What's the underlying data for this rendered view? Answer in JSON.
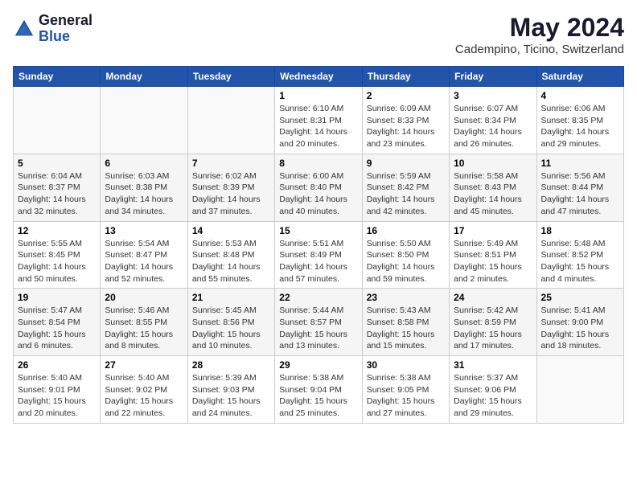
{
  "header": {
    "logo_general": "General",
    "logo_blue": "Blue",
    "title": "May 2024",
    "subtitle": "Cadempino, Ticino, Switzerland"
  },
  "weekdays": [
    "Sunday",
    "Monday",
    "Tuesday",
    "Wednesday",
    "Thursday",
    "Friday",
    "Saturday"
  ],
  "weeks": [
    [
      {
        "day": "",
        "info": ""
      },
      {
        "day": "",
        "info": ""
      },
      {
        "day": "",
        "info": ""
      },
      {
        "day": "1",
        "info": "Sunrise: 6:10 AM\nSunset: 8:31 PM\nDaylight: 14 hours\nand 20 minutes."
      },
      {
        "day": "2",
        "info": "Sunrise: 6:09 AM\nSunset: 8:33 PM\nDaylight: 14 hours\nand 23 minutes."
      },
      {
        "day": "3",
        "info": "Sunrise: 6:07 AM\nSunset: 8:34 PM\nDaylight: 14 hours\nand 26 minutes."
      },
      {
        "day": "4",
        "info": "Sunrise: 6:06 AM\nSunset: 8:35 PM\nDaylight: 14 hours\nand 29 minutes."
      }
    ],
    [
      {
        "day": "5",
        "info": "Sunrise: 6:04 AM\nSunset: 8:37 PM\nDaylight: 14 hours\nand 32 minutes."
      },
      {
        "day": "6",
        "info": "Sunrise: 6:03 AM\nSunset: 8:38 PM\nDaylight: 14 hours\nand 34 minutes."
      },
      {
        "day": "7",
        "info": "Sunrise: 6:02 AM\nSunset: 8:39 PM\nDaylight: 14 hours\nand 37 minutes."
      },
      {
        "day": "8",
        "info": "Sunrise: 6:00 AM\nSunset: 8:40 PM\nDaylight: 14 hours\nand 40 minutes."
      },
      {
        "day": "9",
        "info": "Sunrise: 5:59 AM\nSunset: 8:42 PM\nDaylight: 14 hours\nand 42 minutes."
      },
      {
        "day": "10",
        "info": "Sunrise: 5:58 AM\nSunset: 8:43 PM\nDaylight: 14 hours\nand 45 minutes."
      },
      {
        "day": "11",
        "info": "Sunrise: 5:56 AM\nSunset: 8:44 PM\nDaylight: 14 hours\nand 47 minutes."
      }
    ],
    [
      {
        "day": "12",
        "info": "Sunrise: 5:55 AM\nSunset: 8:45 PM\nDaylight: 14 hours\nand 50 minutes."
      },
      {
        "day": "13",
        "info": "Sunrise: 5:54 AM\nSunset: 8:47 PM\nDaylight: 14 hours\nand 52 minutes."
      },
      {
        "day": "14",
        "info": "Sunrise: 5:53 AM\nSunset: 8:48 PM\nDaylight: 14 hours\nand 55 minutes."
      },
      {
        "day": "15",
        "info": "Sunrise: 5:51 AM\nSunset: 8:49 PM\nDaylight: 14 hours\nand 57 minutes."
      },
      {
        "day": "16",
        "info": "Sunrise: 5:50 AM\nSunset: 8:50 PM\nDaylight: 14 hours\nand 59 minutes."
      },
      {
        "day": "17",
        "info": "Sunrise: 5:49 AM\nSunset: 8:51 PM\nDaylight: 15 hours\nand 2 minutes."
      },
      {
        "day": "18",
        "info": "Sunrise: 5:48 AM\nSunset: 8:52 PM\nDaylight: 15 hours\nand 4 minutes."
      }
    ],
    [
      {
        "day": "19",
        "info": "Sunrise: 5:47 AM\nSunset: 8:54 PM\nDaylight: 15 hours\nand 6 minutes."
      },
      {
        "day": "20",
        "info": "Sunrise: 5:46 AM\nSunset: 8:55 PM\nDaylight: 15 hours\nand 8 minutes."
      },
      {
        "day": "21",
        "info": "Sunrise: 5:45 AM\nSunset: 8:56 PM\nDaylight: 15 hours\nand 10 minutes."
      },
      {
        "day": "22",
        "info": "Sunrise: 5:44 AM\nSunset: 8:57 PM\nDaylight: 15 hours\nand 13 minutes."
      },
      {
        "day": "23",
        "info": "Sunrise: 5:43 AM\nSunset: 8:58 PM\nDaylight: 15 hours\nand 15 minutes."
      },
      {
        "day": "24",
        "info": "Sunrise: 5:42 AM\nSunset: 8:59 PM\nDaylight: 15 hours\nand 17 minutes."
      },
      {
        "day": "25",
        "info": "Sunrise: 5:41 AM\nSunset: 9:00 PM\nDaylight: 15 hours\nand 18 minutes."
      }
    ],
    [
      {
        "day": "26",
        "info": "Sunrise: 5:40 AM\nSunset: 9:01 PM\nDaylight: 15 hours\nand 20 minutes."
      },
      {
        "day": "27",
        "info": "Sunrise: 5:40 AM\nSunset: 9:02 PM\nDaylight: 15 hours\nand 22 minutes."
      },
      {
        "day": "28",
        "info": "Sunrise: 5:39 AM\nSunset: 9:03 PM\nDaylight: 15 hours\nand 24 minutes."
      },
      {
        "day": "29",
        "info": "Sunrise: 5:38 AM\nSunset: 9:04 PM\nDaylight: 15 hours\nand 25 minutes."
      },
      {
        "day": "30",
        "info": "Sunrise: 5:38 AM\nSunset: 9:05 PM\nDaylight: 15 hours\nand 27 minutes."
      },
      {
        "day": "31",
        "info": "Sunrise: 5:37 AM\nSunset: 9:06 PM\nDaylight: 15 hours\nand 29 minutes."
      },
      {
        "day": "",
        "info": ""
      }
    ]
  ]
}
